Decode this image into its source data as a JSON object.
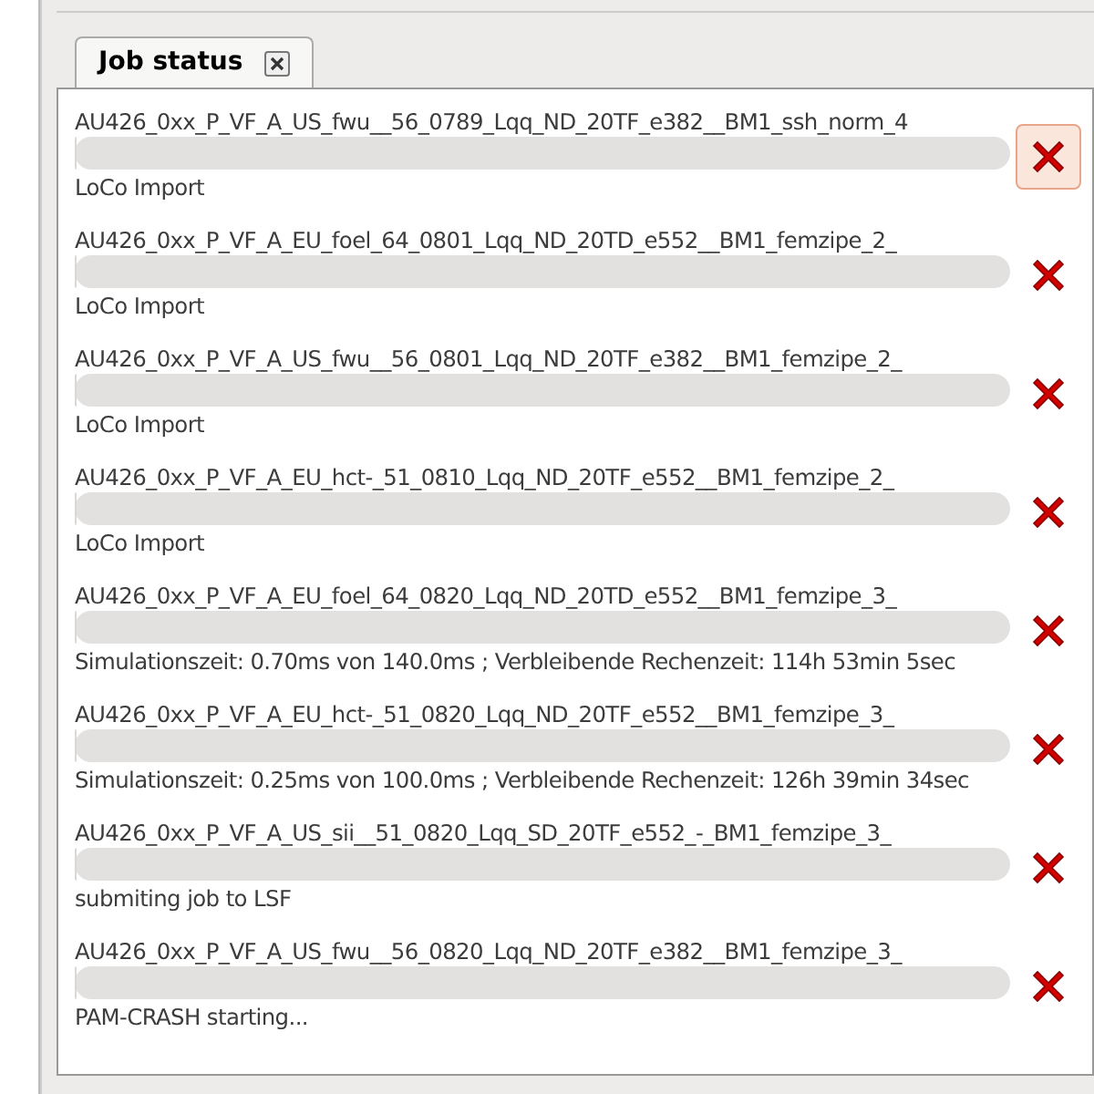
{
  "tab": {
    "label": "Job status",
    "selected": true
  },
  "jobs": [
    {
      "name": "AU426_0xx_P_VF_A_US_fwu__56_0789_Lqq_ND_20TF_e382__BM1_ssh_norm_4",
      "level": 0,
      "status": "LoCo Import",
      "hovered": true
    },
    {
      "name": "AU426_0xx_P_VF_A_EU_foel_64_0801_Lqq_ND_20TD_e552__BM1_femzipe_2_",
      "level": 0,
      "status": "LoCo Import",
      "hovered": false
    },
    {
      "name": "AU426_0xx_P_VF_A_US_fwu__56_0801_Lqq_ND_20TF_e382__BM1_femzipe_2_",
      "level": 0,
      "status": "LoCo Import",
      "hovered": false
    },
    {
      "name": "AU426_0xx_P_VF_A_EU_hct-_51_0810_Lqq_ND_20TF_e552__BM1_femzipe_2_",
      "level": 0,
      "status": "LoCo Import",
      "hovered": false
    },
    {
      "name": "AU426_0xx_P_VF_A_EU_foel_64_0820_Lqq_ND_20TD_e552__BM1_femzipe_3_",
      "level": 0,
      "status": "Simulationszeit: 0.70ms von 140.0ms ; Verbleibende Rechenzeit: 114h 53min 5sec",
      "hovered": false
    },
    {
      "name": "AU426_0xx_P_VF_A_EU_hct-_51_0820_Lqq_ND_20TF_e552__BM1_femzipe_3_",
      "level": 0,
      "status": "Simulationszeit: 0.25ms von 100.0ms ; Verbleibende Rechenzeit: 126h 39min 34sec",
      "hovered": false
    },
    {
      "name": "AU426_0xx_P_VF_A_US_sii__51_0820_Lqq_SD_20TF_e552_-_BM1_femzipe_3_",
      "level": 0,
      "status": "submiting job to LSF",
      "hovered": false
    },
    {
      "name": "AU426_0xx_P_VF_A_US_fwu__56_0820_Lqq_ND_20TF_e382__BM1_femzipe_3_",
      "level": 0,
      "status": "PAM-CRASH starting...",
      "hovered": false
    }
  ]
}
